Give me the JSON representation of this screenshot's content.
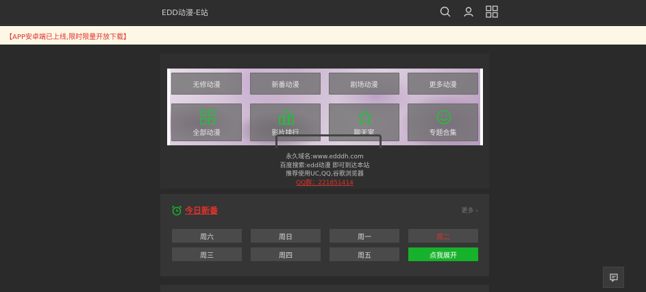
{
  "header": {
    "title": "EDD动漫-E站",
    "icons": [
      "search-icon",
      "user-icon",
      "grid-icon"
    ]
  },
  "notice": {
    "text": "【APP安卓端已上线,限时限量开放下载】"
  },
  "hero": {
    "row1": [
      {
        "label": "无修动漫"
      },
      {
        "label": "新番动漫"
      },
      {
        "label": "剧场动漫"
      },
      {
        "label": "更多动漫"
      }
    ],
    "row2": [
      {
        "label": "全部动漫",
        "icon": "grid-icon"
      },
      {
        "label": "影片排行",
        "icon": "bar-chart-icon"
      },
      {
        "label": "聊天室",
        "icon": "star-icon"
      },
      {
        "label": "专题合集",
        "icon": "smile-icon"
      }
    ]
  },
  "info": {
    "domain": "永久域名:www.edddh.com",
    "search": "百度搜索:edd动漫 即可到达本站",
    "browser": "推荐使用UC,QQ,谷歌浏览器",
    "qq": "QQ群：221851414"
  },
  "schedule": {
    "title": "今日新番",
    "more": "更多",
    "days": [
      "周六",
      "周日",
      "周一",
      "周二",
      "周三",
      "周四",
      "周五"
    ],
    "active_day": "周二",
    "expand": "点我展开"
  },
  "colors": {
    "accent_red": "#e0322b",
    "accent_green": "#16b22b",
    "bg": "#2a2a2a"
  }
}
